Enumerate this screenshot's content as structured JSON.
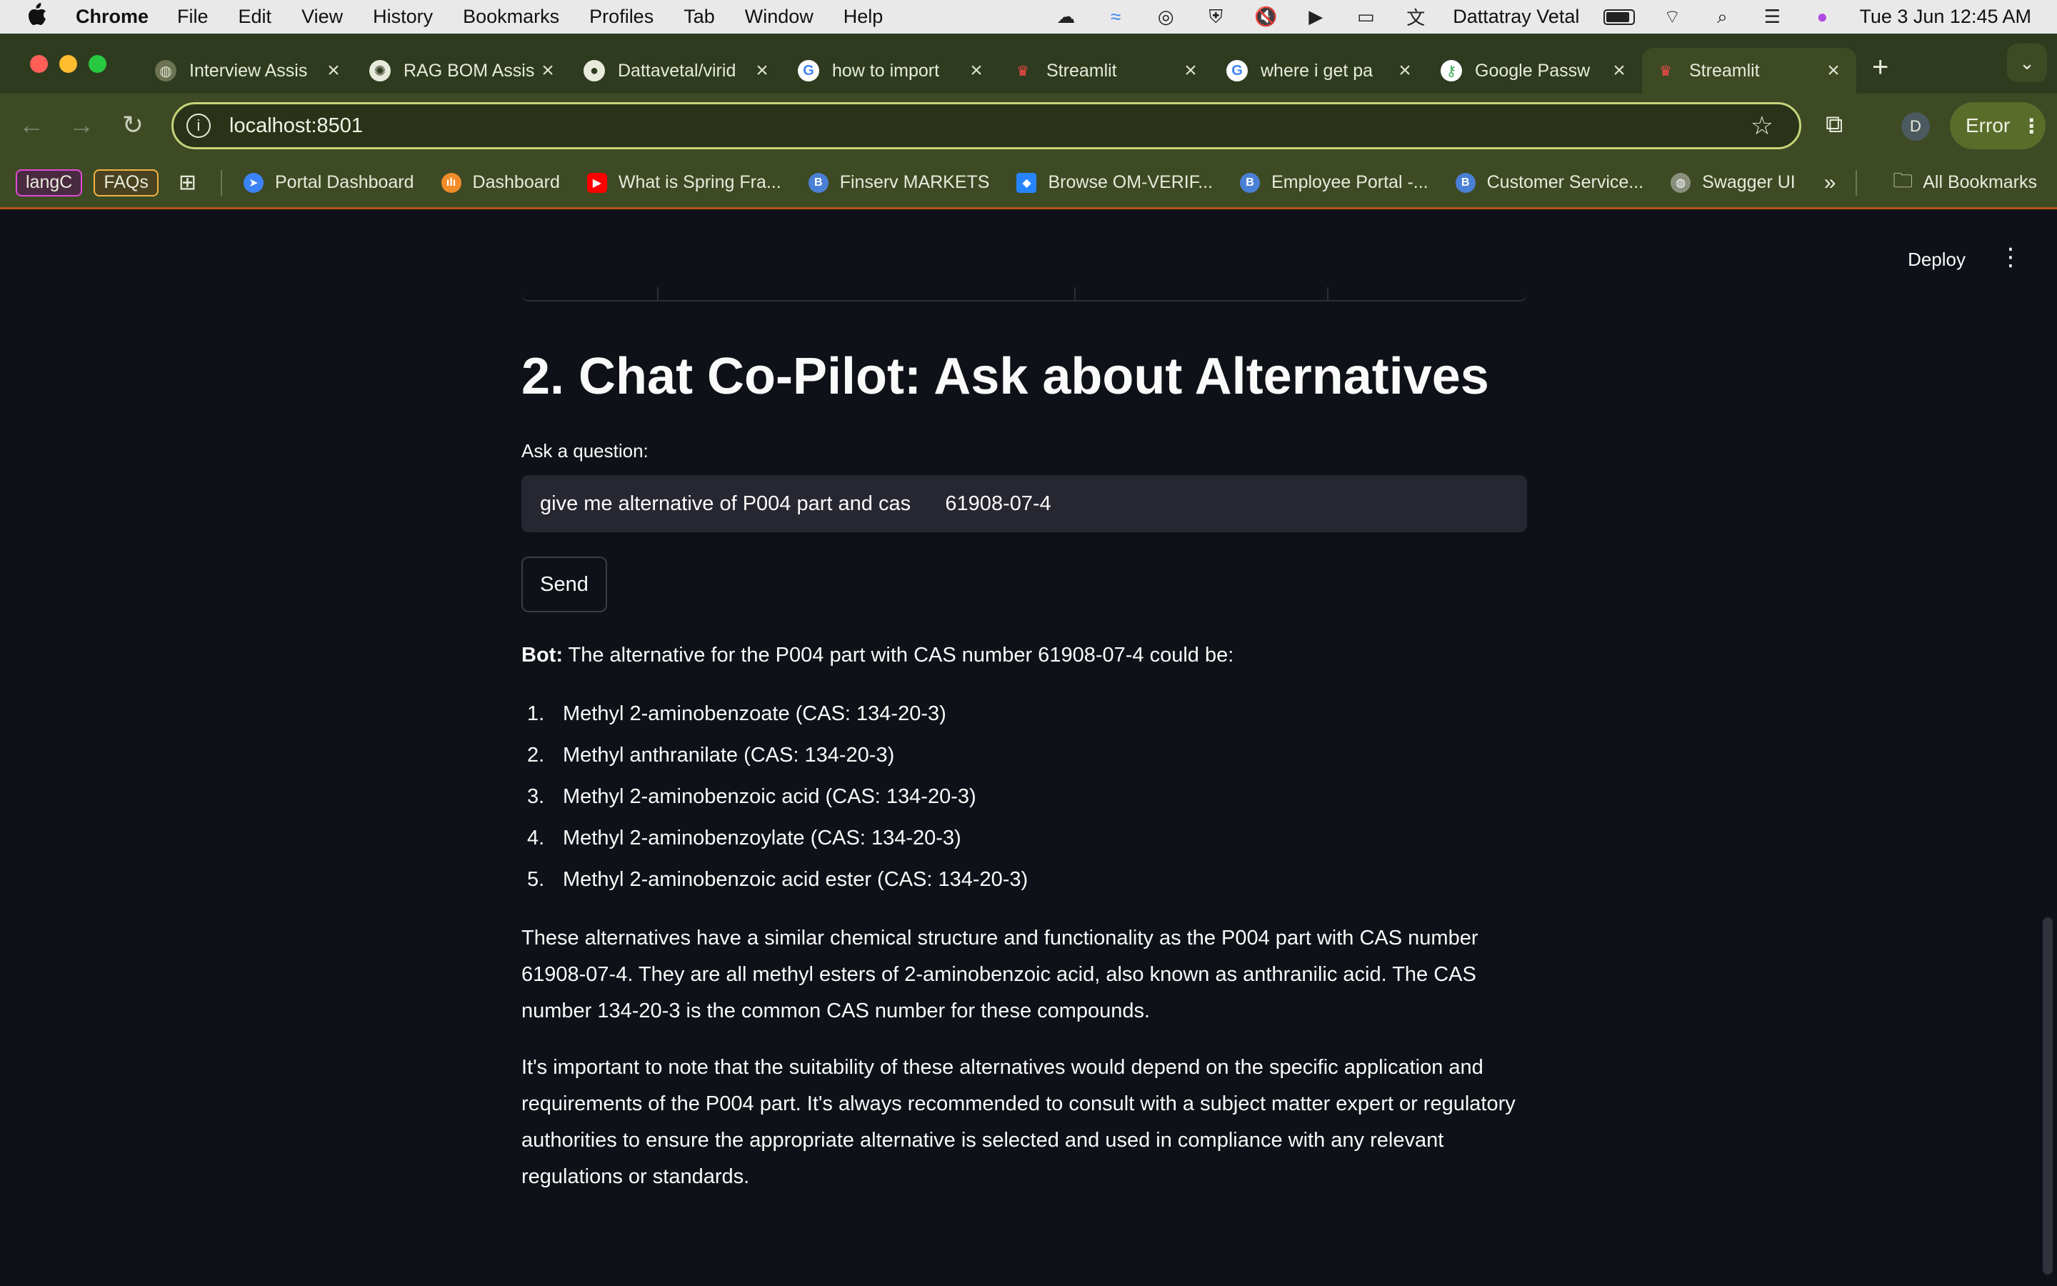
{
  "menubar": {
    "app": "Chrome",
    "items": [
      "File",
      "Edit",
      "View",
      "History",
      "Bookmarks",
      "Profiles",
      "Tab",
      "Window",
      "Help"
    ],
    "user": "Dattatray Vetal",
    "datetime": "Tue 3 Jun  12:45 AM"
  },
  "tabs": [
    {
      "title": "Interview Assis",
      "icon": "globe-icon"
    },
    {
      "title": "RAG BOM Assis",
      "icon": "openai-icon"
    },
    {
      "title": "Dattavetal/virid",
      "icon": "github-icon"
    },
    {
      "title": "how to import",
      "icon": "google-icon"
    },
    {
      "title": "Streamlit",
      "icon": "streamlit-icon"
    },
    {
      "title": "where i get pa",
      "icon": "google-icon"
    },
    {
      "title": "Google Passw",
      "icon": "google-passwords-icon"
    },
    {
      "title": "Streamlit",
      "icon": "streamlit-icon",
      "active": true
    }
  ],
  "toolbar": {
    "url": "localhost:8501",
    "profile_initial": "D",
    "error_label": "Error"
  },
  "bookmarks": {
    "chips": [
      {
        "label": "langC",
        "color": "#e04ad8"
      },
      {
        "label": "FAQs",
        "color": "#f2b441"
      }
    ],
    "items": [
      {
        "label": "Portal Dashboard",
        "icon": "portal-icon",
        "color": "#3b82f6"
      },
      {
        "label": "Dashboard",
        "icon": "dashboard-icon",
        "color": "#f28c28"
      },
      {
        "label": "What is Spring Fra...",
        "icon": "youtube-icon",
        "color": "#ff0000"
      },
      {
        "label": "Finserv MARKETS",
        "icon": "b-icon",
        "color": "#4a7fd6"
      },
      {
        "label": "Browse OM-VERIF...",
        "icon": "jira-icon",
        "color": "#2684ff"
      },
      {
        "label": "Employee Portal -...",
        "icon": "b-icon",
        "color": "#4a7fd6"
      },
      {
        "label": "Customer Service...",
        "icon": "b-icon",
        "color": "#4a7fd6"
      },
      {
        "label": "Swagger UI",
        "icon": "globe-icon",
        "color": "#8a8f7d"
      }
    ],
    "all_bookmarks": "All Bookmarks"
  },
  "app": {
    "deploy_label": "Deploy",
    "heading": "2. Chat Co-Pilot: Ask about Alternatives",
    "input_label": "Ask a question:",
    "input_value": "give me alternative of P004 part and cas      61908-07-4",
    "send_label": "Send",
    "bot_prefix": "Bot:",
    "bot_intro": " The alternative for the P004 part with CAS number 61908-07-4 could be:",
    "alternatives": [
      "Methyl 2-aminobenzoate (CAS: 134-20-3)",
      "Methyl anthranilate (CAS: 134-20-3)",
      "Methyl 2-aminobenzoic acid (CAS: 134-20-3)",
      "Methyl 2-aminobenzoylate (CAS: 134-20-3)",
      "Methyl 2-aminobenzoic acid ester (CAS: 134-20-3)"
    ],
    "paragraph1": "These alternatives have a similar chemical structure and functionality as the P004 part with CAS number 61908-07-4. They are all methyl esters of 2-aminobenzoic acid, also known as anthranilic acid. The CAS number 134-20-3 is the common CAS number for these compounds.",
    "paragraph2": "It's important to note that the suitability of these alternatives would depend on the specific application and requirements of the P004 part. It's always recommended to consult with a subject matter expert or regulatory authorities to ensure the appropriate alternative is selected and used in compliance with any relevant regulations or standards."
  }
}
